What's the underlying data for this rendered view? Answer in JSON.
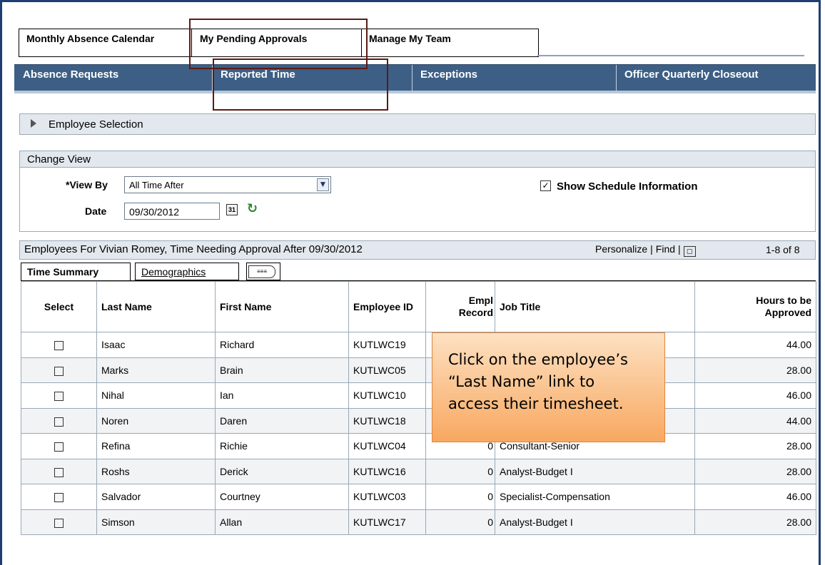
{
  "top_tabs": [
    "Monthly Absence Calendar",
    "My Pending Approvals",
    "Manage My Team"
  ],
  "nav_items": [
    "Absence Requests",
    "Reported Time",
    "Exceptions",
    "Officer Quarterly Closeout"
  ],
  "employee_selection": {
    "label": "Employee Selection"
  },
  "change_view": {
    "title": "Change View",
    "view_by_label": "*View By",
    "view_by_value": "All Time After",
    "date_label": "Date",
    "date_value": "09/30/2012",
    "show_schedule_label": "Show Schedule Information",
    "show_schedule_checked": true
  },
  "grid": {
    "title": "Employees For Vivian Romey, Time Needing Approval After 09/30/2012",
    "personalize": "Personalize",
    "find": "Find",
    "count": "1-8 of 8",
    "tabs": [
      "Time Summary",
      "Demographics"
    ],
    "columns": {
      "select": "Select",
      "last_name": "Last Name",
      "first_name": "First Name",
      "employee_id": "Employee ID",
      "empl_record_1": "Empl",
      "empl_record_2": "Record",
      "job_title": "Job Title",
      "hours_1": "Hours to be",
      "hours_2": "Approved"
    },
    "rows": [
      {
        "last": "Isaac",
        "first": "Richard",
        "id": "KUTLWC19",
        "rec": "",
        "job": "",
        "hours": "44.00"
      },
      {
        "last": "Marks",
        "first": "Brain",
        "id": "KUTLWC05",
        "rec": "",
        "job": "",
        "hours": "28.00"
      },
      {
        "last": "Nihal",
        "first": "Ian",
        "id": "KUTLWC10",
        "rec": "",
        "job": "",
        "hours": "46.00"
      },
      {
        "last": "Noren",
        "first": "Daren",
        "id": "KUTLWC18",
        "rec": "",
        "job": "",
        "hours": "44.00"
      },
      {
        "last": "Refina",
        "first": "Richie",
        "id": "KUTLWC04",
        "rec": "0",
        "job": "Consultant-Senior",
        "hours": "28.00"
      },
      {
        "last": "Roshs",
        "first": "Derick",
        "id": "KUTLWC16",
        "rec": "0",
        "job": "Analyst-Budget I",
        "hours": "28.00"
      },
      {
        "last": "Salvador",
        "first": "Courtney",
        "id": "KUTLWC03",
        "rec": "0",
        "job": "Specialist-Compensation",
        "hours": "46.00"
      },
      {
        "last": "Simson",
        "first": "Allan",
        "id": "KUTLWC17",
        "rec": "0",
        "job": "Analyst-Budget I",
        "hours": "28.00"
      }
    ]
  },
  "callout": {
    "text": "Click on the employee’s “Last Name” link to access their timesheet."
  },
  "colors": {
    "nav_bg": "#3d5f86",
    "highlight_border": "#5a1b14",
    "callout_bg": "#f8a860"
  }
}
